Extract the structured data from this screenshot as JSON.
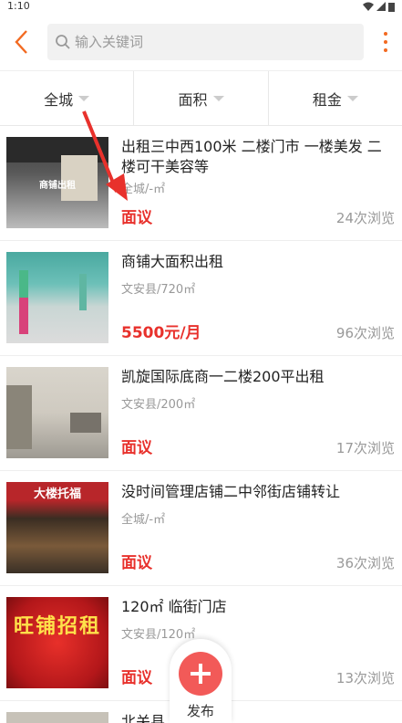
{
  "status": {
    "time": "1:10"
  },
  "search": {
    "placeholder": "输入关键词"
  },
  "filters": [
    "全城",
    "面积",
    "租金"
  ],
  "listings": [
    {
      "title": "出租三中西100米 二楼门市 一楼美发 二楼可干美容等",
      "location": "全城/-㎡",
      "price": "面议",
      "views": "24次浏览",
      "thumb_text": "商铺出租"
    },
    {
      "title": "商铺大面积出租",
      "location": "文安县/720㎡",
      "price": "5500元/月",
      "views": "96次浏览"
    },
    {
      "title": "凯旋国际底商一二楼200平出租",
      "location": "文安县/200㎡",
      "price": "面议",
      "views": "17次浏览"
    },
    {
      "title": "没时间管理店铺二中邻街店铺转让",
      "location": "全城/-㎡",
      "price": "面议",
      "views": "36次浏览",
      "thumb_text": "大楼托福"
    },
    {
      "title": "120㎡ 临街门店",
      "location": "文安县/120㎡",
      "price": "面议",
      "views": "13次浏览",
      "thumb_text": "旺铺招租"
    },
    {
      "title": "北关县... 五百平",
      "location": "",
      "price": "",
      "views": ""
    }
  ],
  "fab": {
    "label": "发布"
  },
  "colors": {
    "accent": "#f26a21",
    "price": "#e8312c",
    "fab": "#f25a58"
  }
}
